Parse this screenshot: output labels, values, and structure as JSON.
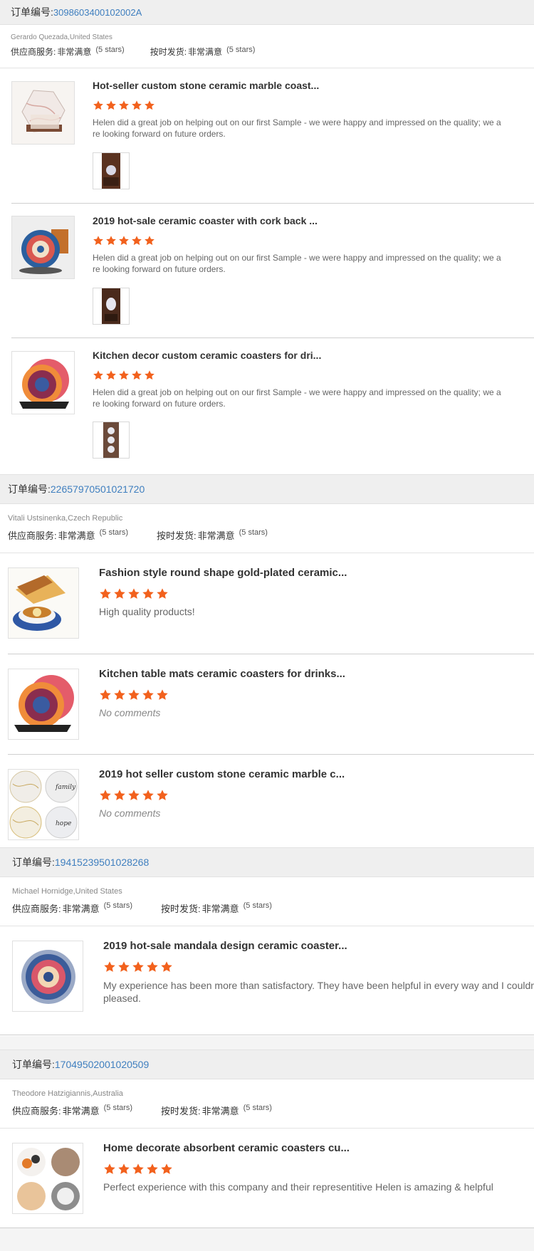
{
  "order_label": "订单编号:",
  "supplier_label": "供应商服务:",
  "shipping_label": "按时发货:",
  "star_color": "#f2611d",
  "link_color": "#3f7fbf",
  "orders": [
    {
      "number": "3098603400102002A",
      "buyer": "Gerardo Quezada,United States",
      "supplier_rating": "非常满意",
      "supplier_stars": "(5 stars)",
      "shipping_rating": "非常满意",
      "shipping_stars": "(5 stars)",
      "products": [
        {
          "title": "Hot-seller custom stone ceramic marble coast...",
          "stars": 5,
          "comment": "Helen did a great job on helping out on our first Sample - we were happy and impressed on the quality; we are looking forward on future orders.",
          "comment_line1": "Helen did a great job on helping out on our first Sample - we were happy and impressed on the quality; we a",
          "comment_line2": "re looking forward on future orders.",
          "thumb_icon": "marble-coaster-thumb",
          "photo_icon": "review-photo-1"
        },
        {
          "title": "2019 hot-sale ceramic coaster with cork back ...",
          "stars": 5,
          "comment_line1": "Helen did a great job on helping out on our first Sample - we were happy and impressed on the quality; we a",
          "comment_line2": "re looking forward on future orders.",
          "thumb_icon": "mandala-coaster-thumb",
          "photo_icon": "review-photo-2"
        },
        {
          "title": "Kitchen decor custom ceramic coasters for dri...",
          "stars": 5,
          "comment_line1": "Helen did a great job on helping out on our first Sample - we were happy and impressed on the quality; we a",
          "comment_line2": "re looking forward on future orders.",
          "thumb_icon": "mandala-holder-thumb",
          "photo_icon": "review-photo-3"
        }
      ]
    },
    {
      "number": "22657970501021720",
      "buyer": "Vitali Ustsinenka,Czech Republic",
      "supplier_rating": "非常满意",
      "supplier_stars": "(5 stars)",
      "shipping_rating": "非常满意",
      "shipping_stars": "(5 stars)",
      "products": [
        {
          "title": "Fashion style round shape gold-plated ceramic...",
          "stars": 5,
          "comment": "High quality products!"
        },
        {
          "title": "Kitchen table mats ceramic coasters for drinks...",
          "stars": 5,
          "comment": "No comments"
        },
        {
          "title": "2019 hot seller custom stone ceramic marble c...",
          "stars": 5,
          "comment": "No comments",
          "thumb_text_1": "family",
          "thumb_text_2": "hope"
        }
      ]
    },
    {
      "number": "19415239501028268",
      "buyer": "Michael Hornidge,United States",
      "supplier_rating": "非常满意",
      "supplier_stars": "(5 stars)",
      "shipping_rating": "非常满意",
      "shipping_stars": "(5 stars)",
      "products": [
        {
          "title": "2019 hot-sale mandala design ceramic coaster...",
          "stars": 5,
          "comment_line1": "My experience has been more than satisfactory. They have been helpful in every way and I couldn't be",
          "comment_line2": "pleased."
        }
      ]
    },
    {
      "number": "17049502001020509",
      "buyer": "Theodore Hatzigiannis,Australia",
      "supplier_rating": "非常满意",
      "supplier_stars": "(5 stars)",
      "shipping_rating": "非常满意",
      "shipping_stars": "(5 stars)",
      "products": [
        {
          "title": "Home decorate absorbent ceramic coasters cu...",
          "stars": 5,
          "comment": "Perfect experience with this company and their representitive Helen is amazing & helpful"
        }
      ]
    }
  ]
}
